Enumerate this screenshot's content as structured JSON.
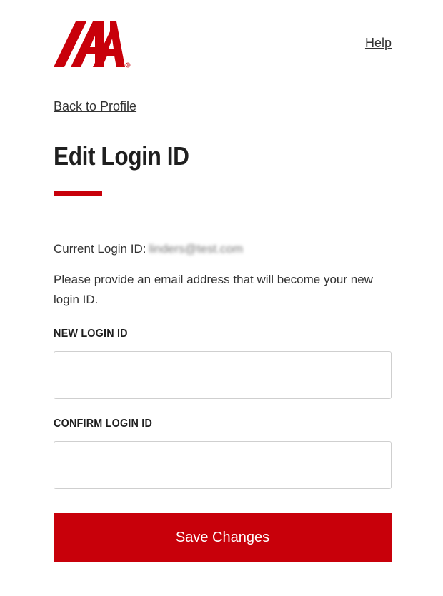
{
  "header": {
    "logo_icon": "iaa-logo-icon",
    "brand_color": "#c8000a",
    "help_label": "Help"
  },
  "nav": {
    "back_label": "Back to Profile"
  },
  "main": {
    "title": "Edit Login ID",
    "current_id_label": "Current Login ID:",
    "current_id_value": "linders@test.com",
    "instructions": "Please provide an email address that will become your new login ID."
  },
  "form": {
    "new_login_label": "NEW LOGIN ID",
    "new_login_value": "",
    "confirm_login_label": "CONFIRM LOGIN ID",
    "confirm_login_value": "",
    "save_label": "Save Changes"
  }
}
